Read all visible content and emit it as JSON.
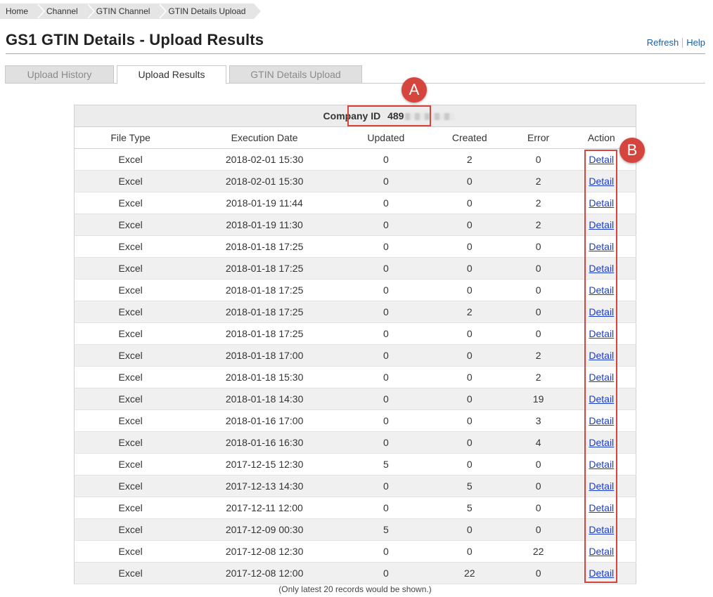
{
  "breadcrumb": [
    "Home",
    "Channel",
    "GTIN Channel",
    "GTIN Details Upload"
  ],
  "page_title": "GS1 GTIN Details - Upload Results",
  "header_links": {
    "refresh": "Refresh",
    "help": "Help"
  },
  "tabs": [
    "Upload History",
    "Upload Results",
    "GTIN Details Upload"
  ],
  "active_tab": "Upload Results",
  "company": {
    "label": "Company ID",
    "value_prefix": "489"
  },
  "columns": [
    "File Type",
    "Execution Date",
    "Updated",
    "Created",
    "Error",
    "Action"
  ],
  "rows": [
    [
      "Excel",
      "2018-02-01 15:30",
      "0",
      "2",
      "0",
      "Detail"
    ],
    [
      "Excel",
      "2018-02-01 15:30",
      "0",
      "0",
      "2",
      "Detail"
    ],
    [
      "Excel",
      "2018-01-19 11:44",
      "0",
      "0",
      "2",
      "Detail"
    ],
    [
      "Excel",
      "2018-01-19 11:30",
      "0",
      "0",
      "2",
      "Detail"
    ],
    [
      "Excel",
      "2018-01-18 17:25",
      "0",
      "0",
      "0",
      "Detail"
    ],
    [
      "Excel",
      "2018-01-18 17:25",
      "0",
      "0",
      "0",
      "Detail"
    ],
    [
      "Excel",
      "2018-01-18 17:25",
      "0",
      "0",
      "0",
      "Detail"
    ],
    [
      "Excel",
      "2018-01-18 17:25",
      "0",
      "2",
      "0",
      "Detail"
    ],
    [
      "Excel",
      "2018-01-18 17:25",
      "0",
      "0",
      "0",
      "Detail"
    ],
    [
      "Excel",
      "2018-01-18 17:00",
      "0",
      "0",
      "2",
      "Detail"
    ],
    [
      "Excel",
      "2018-01-18 15:30",
      "0",
      "0",
      "2",
      "Detail"
    ],
    [
      "Excel",
      "2018-01-18 14:30",
      "0",
      "0",
      "19",
      "Detail"
    ],
    [
      "Excel",
      "2018-01-16 17:00",
      "0",
      "0",
      "3",
      "Detail"
    ],
    [
      "Excel",
      "2018-01-16 16:30",
      "0",
      "0",
      "4",
      "Detail"
    ],
    [
      "Excel",
      "2017-12-15 12:30",
      "5",
      "0",
      "0",
      "Detail"
    ],
    [
      "Excel",
      "2017-12-13 14:30",
      "0",
      "5",
      "0",
      "Detail"
    ],
    [
      "Excel",
      "2017-12-11 12:00",
      "0",
      "5",
      "0",
      "Detail"
    ],
    [
      "Excel",
      "2017-12-09 00:30",
      "5",
      "0",
      "0",
      "Detail"
    ],
    [
      "Excel",
      "2017-12-08 12:30",
      "0",
      "0",
      "22",
      "Detail"
    ],
    [
      "Excel",
      "2017-12-08 12:00",
      "0",
      "22",
      "0",
      "Detail"
    ]
  ],
  "footnote": "(Only latest 20 records would be shown.)",
  "callouts": {
    "a": "A",
    "b": "B"
  },
  "colors": {
    "accent_red": "#d6453d",
    "link_blue": "#1a3cc8",
    "header_link": "#1a5ea8"
  }
}
